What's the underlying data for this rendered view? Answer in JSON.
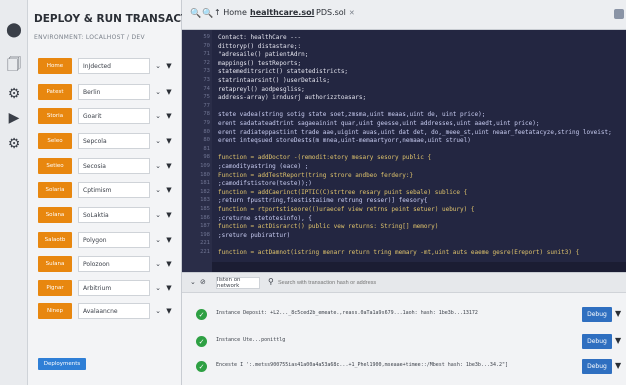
{
  "panel": {
    "title": "DEPLOY & RUN TRANSACTIONS",
    "environment": "ENVIRONMENT: LOCALHOST / DEV",
    "deploy_label": "Deployments",
    "rows": [
      {
        "button": "Home",
        "value": "InJdected"
      },
      {
        "button": "Patest",
        "value": "Berlin"
      },
      {
        "button": "Storia",
        "value": "Goarit"
      },
      {
        "button": "Seleo",
        "value": "Sepcola"
      },
      {
        "button": "Setieo",
        "value": "Secosia"
      },
      {
        "button": "Solaria",
        "value": "Cptimism"
      },
      {
        "button": "Solana",
        "value": "SoLaktia"
      },
      {
        "button": "Salaotb",
        "value": "Polygon"
      },
      {
        "button": "Sulana",
        "value": "Polozoon"
      },
      {
        "button": "Pignar",
        "value": "Arbitrium"
      },
      {
        "button": "Ninep",
        "value": "Avalaancne"
      }
    ]
  },
  "tabs": {
    "home": "Home",
    "active": "healthcare.sol",
    "second": "PDS.sol"
  },
  "editor": {
    "lines": [
      {
        "n": "59",
        "text": "Contact: healthCare  ---",
        "color": "#e6e6f0"
      },
      {
        "n": "70",
        "text": "  dittoryp() distastare;:",
        "color": "#e6e6f0"
      },
      {
        "n": "71",
        "text": "  \"adresaile() patientAdrn;",
        "color": "#e6e6f0"
      },
      {
        "n": "72",
        "text": "  mappings() testReports;",
        "color": "#e6e6f0"
      },
      {
        "n": "73",
        "text": "  statemeditrsrict() statetedistricts;",
        "color": "#e6e6f0"
      },
      {
        "n": "73",
        "text": "  statrintaarsint() )userDetails;",
        "color": "#e6e6f0"
      },
      {
        "n": "74",
        "text": "  retapreyl() aodpesgliss;",
        "color": "#e6e6f0"
      },
      {
        "n": "75",
        "text": "  address-array) irndusrj authorizztoasars;",
        "color": "#e6e6f0"
      },
      {
        "n": "77",
        "text": "",
        "color": "#e6e6f0"
      },
      {
        "n": "78",
        "text": "  stete vadea(string sotig state soet,zmsma,uint meaas,uint de, uint price);",
        "color": "#c9cdf2"
      },
      {
        "n": "79",
        "text": "  erent sadatateadtrint sagaeainint quar,uint geesse,uint addresses,uint aaedt,uint price);",
        "color": "#c9cdf2"
      },
      {
        "n": "80",
        "text": "  erent radiateppastiint trade aae,uigint auas,uint dat det, do,_meee_st,uint neaar_feetatacyze,string loveist;",
        "color": "#c9cdf2"
      },
      {
        "n": "80",
        "text": "  erent inteqsued storeDests(m mnea,uint-memaartyorr,nemaae,uint struel)",
        "color": "#c9cdf2"
      },
      {
        "n": "81",
        "text": "",
        "color": "#e6e6f0"
      },
      {
        "n": "98",
        "text": "  function = addDoctor  -(remodit:etory mesary sesory public {",
        "color": "#e0c46c"
      },
      {
        "n": "109",
        "text": "    ;camodityastring (eace) ;",
        "color": "#c9cdf2"
      },
      {
        "n": "180",
        "text": "  Function = addTestReport(tring strore andbeo ferdery:}",
        "color": "#e0c46c"
      },
      {
        "n": "181",
        "text": "    ;camodifstistore(teste));)",
        "color": "#c9cdf2"
      },
      {
        "n": "182",
        "text": "  function = addCaerinct(IPTIC(C)strtree resary puint sebale) sublice {",
        "color": "#e0c46c"
      },
      {
        "n": "183",
        "text": "    ;return fpusttring,fiestistaiime retrung resser)] feesory{",
        "color": "#c9cdf2"
      },
      {
        "n": "185",
        "text": "  function = rtportstiseore(()uraecef view retrns peint setuer) uebury) {",
        "color": "#e0c46c"
      },
      {
        "n": "186",
        "text": "    ;creturne stetotesinfo), {",
        "color": "#c9cdf2"
      },
      {
        "n": "187",
        "text": "  function = actDisrarct() public vew returns: String[] memory)",
        "color": "#e0c46c"
      },
      {
        "n": "198",
        "text": "    ;sreture pubirattur)",
        "color": "#c9cdf2"
      },
      {
        "n": "221",
        "text": "",
        "color": "#e6e6f0"
      },
      {
        "n": "221",
        "text": "  function = actDamnot(istring menarr return tring memary -mt,uint auts eaeme gesre(Ereport) sunit3) {",
        "color": "#e0c46c"
      }
    ]
  },
  "terminal": {
    "listen_label": "listen on network",
    "search_placeholder": "Search with transaction hash or address",
    "logs": [
      {
        "text": "Instance Deposit: +L2..._8c5ced2b_emeate.,reass.0aTa1a9s679...1aoh: hash: 1be3b...13172",
        "debug": "Debug"
      },
      {
        "text": "Instance Ute...ponittlg",
        "debug": "Debug"
      },
      {
        "text": "Enceste I ':.metss900755ias41a00a4a53a68c...+1_Phel1900,mseaae+timee::/Mbest hash: 1be3b...34.2\"]",
        "debug": "Debug"
      }
    ]
  }
}
